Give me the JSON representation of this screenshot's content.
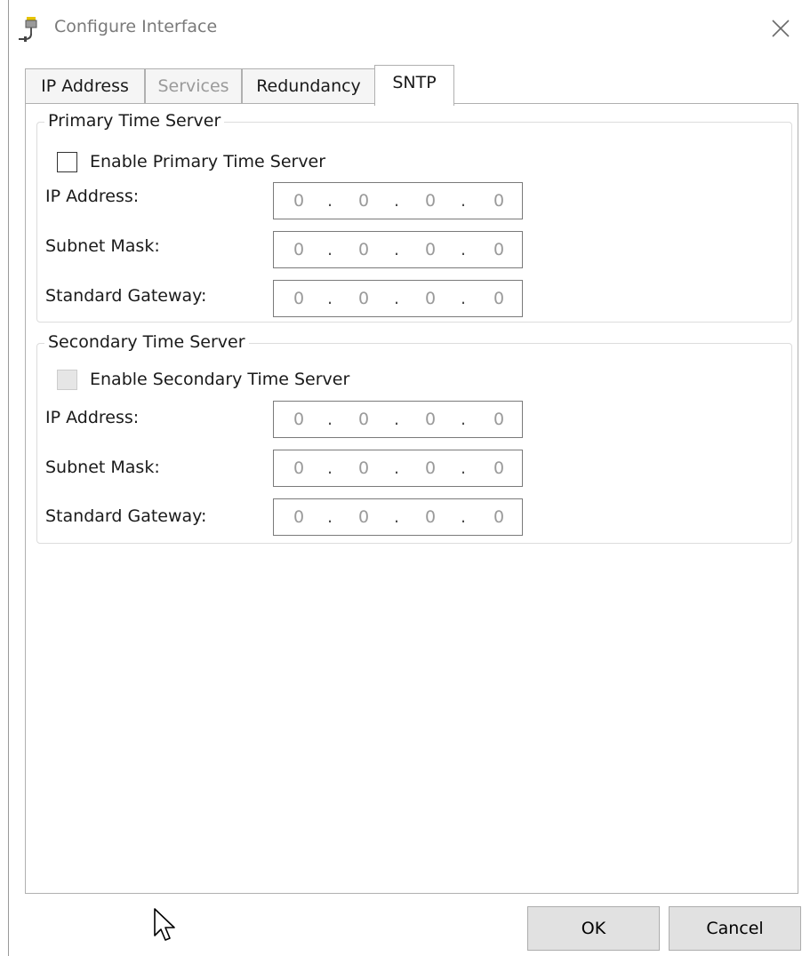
{
  "window": {
    "title": "Configure Interface",
    "close_icon": "close-icon",
    "app_icon": "network-connector-icon"
  },
  "tabs": [
    {
      "label": "IP Address",
      "state": "normal"
    },
    {
      "label": "Services",
      "state": "disabled"
    },
    {
      "label": "Redundancy",
      "state": "normal"
    },
    {
      "label": "SNTP",
      "state": "active"
    }
  ],
  "primary": {
    "group_title": "Primary Time Server",
    "enable_label": "Enable Primary Time Server",
    "enable_checked": false,
    "enable_disabled": false,
    "fields": [
      {
        "label": "IP Address:",
        "octets": [
          "0",
          "0",
          "0",
          "0"
        ]
      },
      {
        "label": "Subnet Mask:",
        "octets": [
          "0",
          "0",
          "0",
          "0"
        ]
      },
      {
        "label": "Standard Gateway:",
        "octets": [
          "0",
          "0",
          "0",
          "0"
        ]
      }
    ]
  },
  "secondary": {
    "group_title": "Secondary Time Server",
    "enable_label": "Enable Secondary Time Server",
    "enable_checked": false,
    "enable_disabled": true,
    "fields": [
      {
        "label": "IP Address:",
        "octets": [
          "0",
          "0",
          "0",
          "0"
        ]
      },
      {
        "label": "Subnet Mask:",
        "octets": [
          "0",
          "0",
          "0",
          "0"
        ]
      },
      {
        "label": "Standard Gateway:",
        "octets": [
          "0",
          "0",
          "0",
          "0"
        ]
      }
    ]
  },
  "ip_separator": ".",
  "buttons": {
    "ok": "OK",
    "cancel": "Cancel"
  },
  "colors": {
    "button_face": "#e1e1e1",
    "disabled_text": "#9a9a9a",
    "border": "#b0b0b0"
  }
}
